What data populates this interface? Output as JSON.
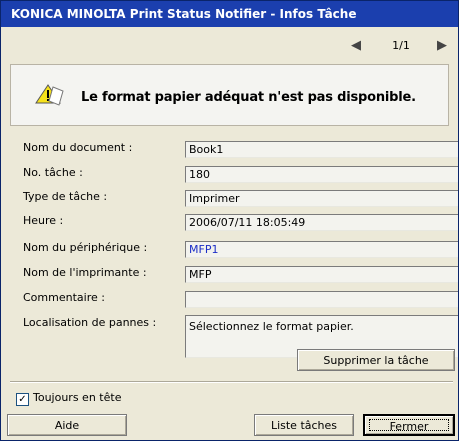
{
  "window": {
    "title": "KONICA MINOLTA Print Status Notifier - Infos Tâche"
  },
  "nav": {
    "page": "1/1",
    "prev_icon": "arrow-left-icon",
    "next_icon": "arrow-right-icon"
  },
  "message": {
    "icon": "warning-paper-icon",
    "text": "Le format papier adéquat n'est pas disponible."
  },
  "fields": [
    {
      "label": "Nom du document :",
      "value": "Book1"
    },
    {
      "label": "No. tâche :",
      "value": "180"
    },
    {
      "label": "Type de tâche :",
      "value": "Imprimer"
    },
    {
      "label": "Heure :",
      "value": "2006/07/11 18:05:49"
    },
    {
      "label": "Nom du périphérique :",
      "value": "MFP1"
    },
    {
      "label": "Nom de l'imprimante :",
      "value": "MFP"
    },
    {
      "label": "Commentaire :",
      "value": ""
    },
    {
      "label": "Localisation de pannes :",
      "value": "Sélectionnez le format papier."
    }
  ],
  "buttons": {
    "delete_job": "Supprimer la tâche",
    "help": "Aide",
    "job_list": "Liste tâches",
    "close": "Fermer"
  },
  "options": {
    "always_on_top_label": "Toujours en tête",
    "always_on_top_checked": true
  }
}
